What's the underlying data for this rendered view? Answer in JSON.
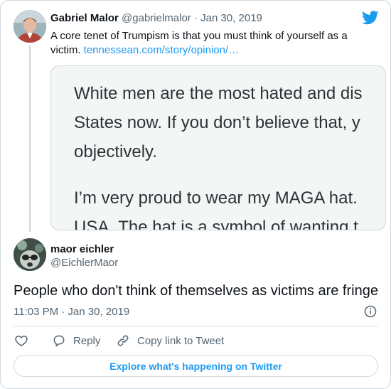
{
  "parent_tweet": {
    "name": "Gabriel Malor",
    "handle": "@gabrielmalor",
    "separator": "·",
    "date": "Jan 30, 2019",
    "text": "A core tenet of Trumpism is that you must think of yourself as a victim.",
    "link_text": "tennessean.com/story/opinion/…",
    "quoted_image_lines": [
      "White men are the most hated and dis",
      "States now. If you don’t believe that, y",
      "objectively.",
      "I’m very proud to wear my MAGA hat.",
      "USA. The hat is a symbol of wanting t"
    ]
  },
  "main_tweet": {
    "name": "maor eichler",
    "handle": "@EichlerMaor",
    "text": "People who don't think of themselves as victims are fringe",
    "time": "11:03 PM · Jan 30, 2019"
  },
  "actions": {
    "reply_label": "Reply",
    "copy_label": "Copy link to Tweet"
  },
  "explore_label": "Explore what's happening on Twitter",
  "colors": {
    "accent": "#1d9bf0",
    "secondary_text": "#536471",
    "border": "#cfd9de",
    "like_icon": "#536471"
  },
  "icons": [
    "twitter-bird-icon",
    "info-icon",
    "heart-icon",
    "reply-icon",
    "link-icon"
  ]
}
